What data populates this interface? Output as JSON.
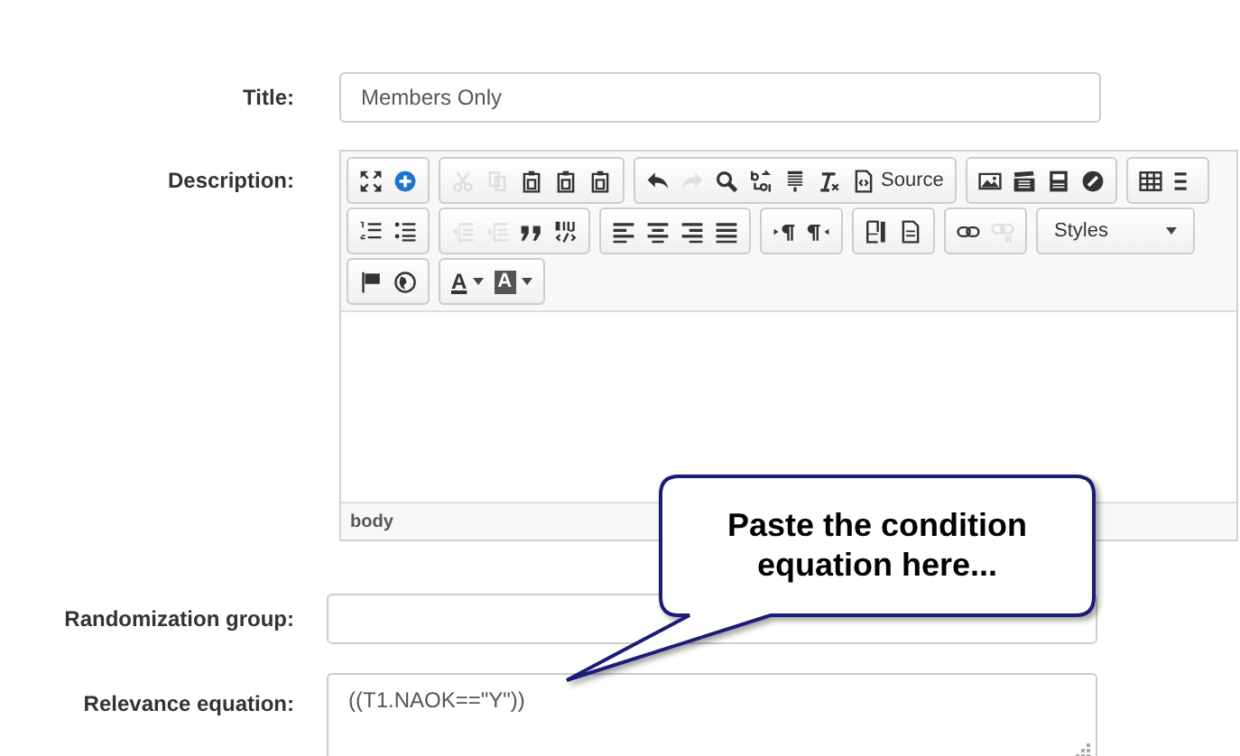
{
  "fields": [
    {
      "kind": "input",
      "label": "Title:",
      "value": "Members Only"
    },
    {
      "kind": "editor",
      "label": "Description:",
      "path": "body",
      "toolbar": [
        [
          {
            "buttons": [
              {
                "kind": "maximize",
                "disabled": false
              },
              {
                "kind": "add",
                "disabled": false
              }
            ]
          },
          {
            "buttons": [
              {
                "kind": "cut",
                "disabled": true
              },
              {
                "kind": "copy",
                "disabled": true
              },
              {
                "kind": "paste",
                "disabled": false
              },
              {
                "kind": "paste",
                "disabled": false
              },
              {
                "kind": "paste",
                "disabled": false
              }
            ]
          },
          {
            "buttons": [
              {
                "kind": "undo",
                "disabled": false
              },
              {
                "kind": "redo",
                "disabled": true
              },
              {
                "kind": "find",
                "disabled": false
              },
              {
                "kind": "replace",
                "disabled": false
              },
              {
                "kind": "lines",
                "disabled": false
              },
              {
                "kind": "clear",
                "disabled": false
              },
              {
                "kind": "source",
                "label": "Source",
                "disabled": false
              }
            ]
          },
          {
            "buttons": [
              {
                "kind": "image",
                "disabled": false
              },
              {
                "kind": "film",
                "disabled": false
              },
              {
                "kind": "video",
                "disabled": false
              },
              {
                "kind": "compass",
                "disabled": false
              }
            ]
          },
          {
            "buttons": [
              {
                "kind": "table",
                "disabled": false
              },
              {
                "kind": "rule",
                "disabled": false
              }
            ]
          }
        ],
        [
          {
            "buttons": [
              {
                "kind": "numbered",
                "disabled": false
              },
              {
                "kind": "bulleted",
                "disabled": false
              }
            ]
          },
          {
            "buttons": [
              {
                "kind": "outdent",
                "disabled": true
              },
              {
                "kind": "indent",
                "disabled": true
              },
              {
                "kind": "quote",
                "disabled": false
              },
              {
                "kind": "div",
                "disabled": false
              }
            ]
          },
          {
            "buttons": [
              {
                "kind": "left",
                "disabled": false
              },
              {
                "kind": "center",
                "disabled": false
              },
              {
                "kind": "right",
                "disabled": false
              },
              {
                "kind": "justify",
                "disabled": false
              }
            ]
          },
          {
            "buttons": [
              {
                "kind": "ltr",
                "disabled": false
              },
              {
                "kind": "rtl",
                "disabled": false
              }
            ]
          },
          {
            "buttons": [
              {
                "kind": "pagebreak",
                "disabled": false
              },
              {
                "kind": "document",
                "disabled": false
              }
            ]
          },
          {
            "buttons": [
              {
                "kind": "link",
                "disabled": false
              },
              {
                "kind": "unlink",
                "disabled": true
              }
            ]
          },
          {
            "buttons": [
              {
                "kind": "dropdown",
                "label": "Styles",
                "disabled": false
              }
            ]
          }
        ],
        [
          {
            "buttons": [
              {
                "kind": "flag",
                "disabled": false
              },
              {
                "kind": "globe",
                "disabled": false
              }
            ]
          },
          {
            "buttons": [
              {
                "kind": "textcolor",
                "label": "A",
                "disabled": false
              },
              {
                "kind": "bgcolor",
                "label": "A",
                "disabled": false
              }
            ]
          }
        ]
      ]
    },
    {
      "kind": "input",
      "label": "Randomization group:"
    },
    {
      "kind": "textarea",
      "label": "Relevance equation:",
      "value": "((T1.NAOK==\"Y\"))"
    }
  ],
  "callout": {
    "text": "Paste the condition equation here..."
  }
}
